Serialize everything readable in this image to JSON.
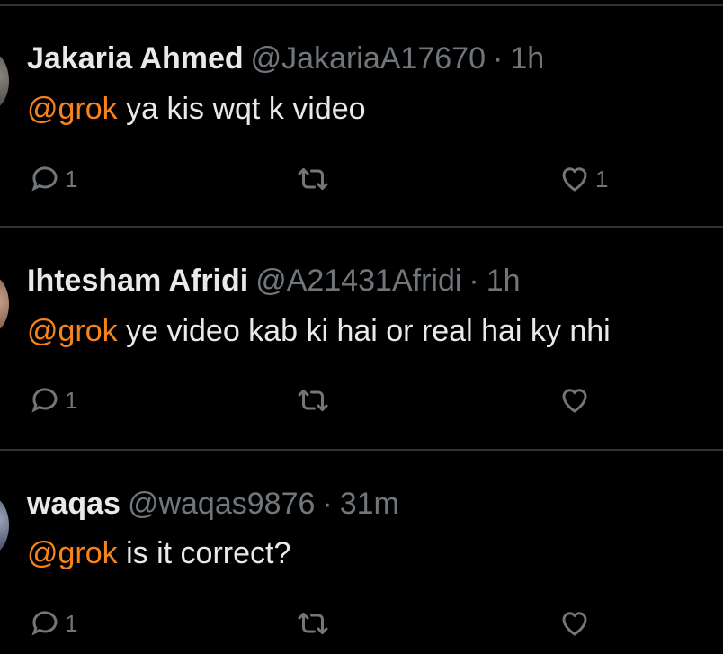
{
  "colors": {
    "background": "#000000",
    "divider": "#2f3336",
    "text_primary": "#e7e9ea",
    "text_secondary": "#71767b",
    "mention": "#f7841b"
  },
  "replies": [
    {
      "name": "Jakaria Ahmed",
      "handle": "@JakariaA17670",
      "separator": "·",
      "time": "1h",
      "mention": "@grok",
      "text": " ya kis wqt k video",
      "reply_icon": "reply-icon",
      "reply_count": "1",
      "retweet_icon": "retweet-icon",
      "retweet_count": "",
      "like_icon": "heart-icon",
      "like_count": "1"
    },
    {
      "name": "Ihtesham Afridi",
      "handle": "@A21431Afridi",
      "separator": "·",
      "time": "1h",
      "mention": "@grok",
      "text": " ye video kab ki hai or real hai ky nhi",
      "reply_icon": "reply-icon",
      "reply_count": "1",
      "retweet_icon": "retweet-icon",
      "retweet_count": "",
      "like_icon": "heart-icon",
      "like_count": ""
    },
    {
      "name": "waqas",
      "handle": "@waqas9876",
      "separator": "·",
      "time": "31m",
      "mention": "@grok",
      "text": " is it correct?",
      "reply_icon": "reply-icon",
      "reply_count": "1",
      "retweet_icon": "retweet-icon",
      "retweet_count": "",
      "like_icon": "heart-icon",
      "like_count": ""
    }
  ]
}
